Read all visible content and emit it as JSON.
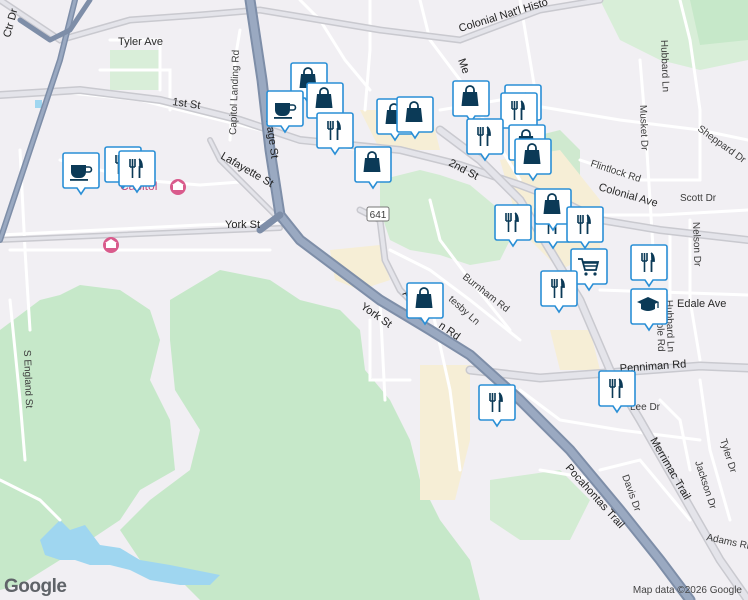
{
  "map": {
    "streets": {
      "colonial_natl_hist": "Colonial Nat'l Histo",
      "tyler_ave": "Tyler Ave",
      "first_st": "1st St",
      "capitol_landing_rd": "Capitol Landing Rd",
      "page_st": "Page St",
      "lafayette_st": "Lafayette St",
      "york_st_west": "York St",
      "york_st_east": "York St",
      "second_st": "2nd St",
      "merrimac_top": "Me",
      "hubbard_ln": "Hubbard Ln",
      "musket_dr": "Musket Dr",
      "sheppard_dr": "Sheppard Dr",
      "flintlock_rd": "Flintlock Rd",
      "colonial_ave": "Colonial Ave",
      "scott_dr": "Scott Dr",
      "nelson_dr": "Nelson Dr",
      "w_semple_rd": "W Semple Rd",
      "hubbard_ln_lower": "Hubbard Ln",
      "edale_ave": "Edale Ave",
      "burnham_rd": "Burnham Rd",
      "penniman_rd": "Penniman Rd",
      "lee_dr": "Lee Dr",
      "tyler_dr": "Tyler Dr",
      "jackson_dr": "Jackson Dr",
      "davis_dr": "Davis Dr",
      "merrimac_trail": "Merrimac Trail",
      "pocahontas_trail": "Pocahontas Trail",
      "adams_rd": "Adams Ri",
      "s_england_st": "S England St",
      "ctr_dr": "Ctr Dr",
      "parkway_fragment": "P",
      "bun_rd": "n Rd",
      "tesby_ln": "tesby Ln"
    },
    "route_shield": "641",
    "landmarks": {
      "capitol": "Capitol"
    },
    "pins": [
      {
        "icon": "shopping-bag-icon"
      },
      {
        "icon": "shopping-bag-icon"
      },
      {
        "icon": "coffee-icon"
      },
      {
        "icon": "shopping-bag-icon"
      },
      {
        "icon": "shopping-bag-icon"
      },
      {
        "icon": "restaurant-icon"
      },
      {
        "icon": "shopping-bag-icon"
      },
      {
        "icon": "shopping-bag-icon"
      },
      {
        "icon": "restaurant-icon"
      },
      {
        "icon": "restaurant-icon"
      },
      {
        "icon": "shopping-bag-icon"
      },
      {
        "icon": "coffee-icon"
      },
      {
        "icon": "restaurant-icon"
      },
      {
        "icon": "restaurant-icon"
      },
      {
        "icon": "restaurant-icon"
      },
      {
        "icon": "shopping-bag-icon"
      },
      {
        "icon": "restaurant-icon"
      },
      {
        "icon": "restaurant-icon"
      },
      {
        "icon": "shopping-bag-icon"
      },
      {
        "icon": "restaurant-icon"
      },
      {
        "icon": "shopping-cart-icon"
      },
      {
        "icon": "restaurant-icon"
      },
      {
        "icon": "restaurant-icon"
      },
      {
        "icon": "school-icon"
      },
      {
        "icon": "shopping-bag-icon"
      },
      {
        "icon": "restaurant-icon"
      },
      {
        "icon": "restaurant-icon"
      }
    ],
    "logo": "Google",
    "attribution": "Map data ©2026 Google"
  }
}
